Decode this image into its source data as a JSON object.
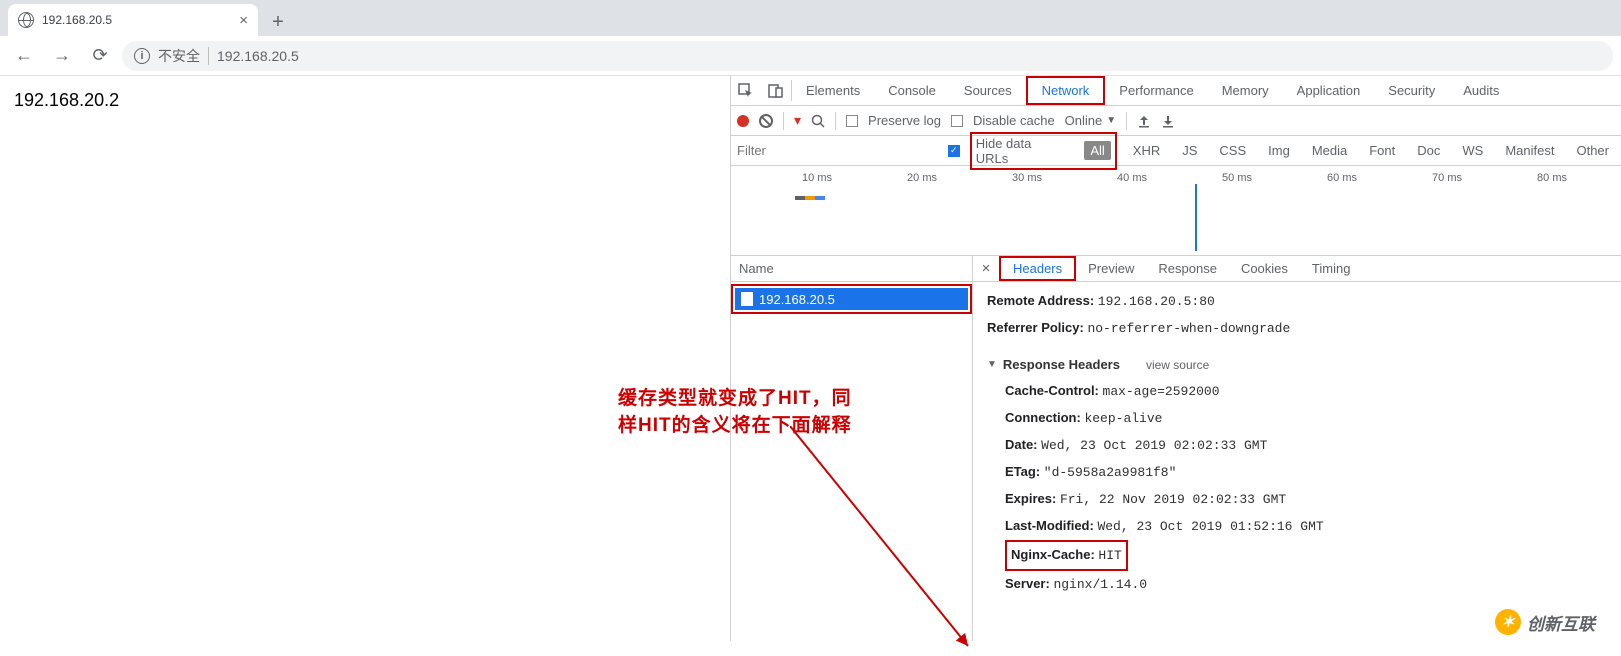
{
  "browser": {
    "tab_title": "192.168.20.5",
    "url_insecure_label": "不安全",
    "url": "192.168.20.5"
  },
  "page_body_text": "192.168.20.2",
  "annotation": {
    "line1": "缓存类型就变成了HIT，同",
    "line2": "样HIT的含义将在下面解释"
  },
  "devtools": {
    "tabs": {
      "elements": "Elements",
      "console": "Console",
      "sources": "Sources",
      "network": "Network",
      "performance": "Performance",
      "memory": "Memory",
      "application": "Application",
      "security": "Security",
      "audits": "Audits"
    },
    "toolbar": {
      "preserve_log": "Preserve log",
      "disable_cache": "Disable cache",
      "throttle": "Online"
    },
    "filter": {
      "placeholder": "Filter",
      "hide_data_urls": "Hide data URLs",
      "types": {
        "all": "All",
        "xhr": "XHR",
        "js": "JS",
        "css": "CSS",
        "img": "Img",
        "media": "Media",
        "font": "Font",
        "doc": "Doc",
        "ws": "WS",
        "manifest": "Manifest",
        "other": "Other"
      }
    },
    "timeline": {
      "ticks": [
        "10 ms",
        "20 ms",
        "30 ms",
        "40 ms",
        "50 ms",
        "60 ms",
        "70 ms",
        "80 ms"
      ]
    },
    "name_col": {
      "header": "Name",
      "item": "192.168.20.5"
    },
    "detail_tabs": {
      "headers": "Headers",
      "preview": "Preview",
      "response": "Response",
      "cookies": "Cookies",
      "timing": "Timing"
    },
    "headers": {
      "remote_address_label": "Remote Address:",
      "remote_address": "192.168.20.5:80",
      "referrer_policy_label": "Referrer Policy:",
      "referrer_policy": "no-referrer-when-downgrade",
      "response_headers_label": "Response Headers",
      "view_source": "view source",
      "cache_control_label": "Cache-Control:",
      "cache_control": "max-age=2592000",
      "connection_label": "Connection:",
      "connection": "keep-alive",
      "date_label": "Date:",
      "date": "Wed, 23 Oct 2019 02:02:33 GMT",
      "etag_label": "ETag:",
      "etag": "\"d-5958a2a9981f8\"",
      "expires_label": "Expires:",
      "expires": "Fri, 22 Nov 2019 02:02:33 GMT",
      "last_modified_label": "Last-Modified:",
      "last_modified": "Wed, 23 Oct 2019 01:52:16 GMT",
      "nginx_cache_label": "Nginx-Cache:",
      "nginx_cache": "HIT",
      "server_label": "Server:",
      "server": "nginx/1.14.0"
    }
  },
  "watermark": "创新互联"
}
